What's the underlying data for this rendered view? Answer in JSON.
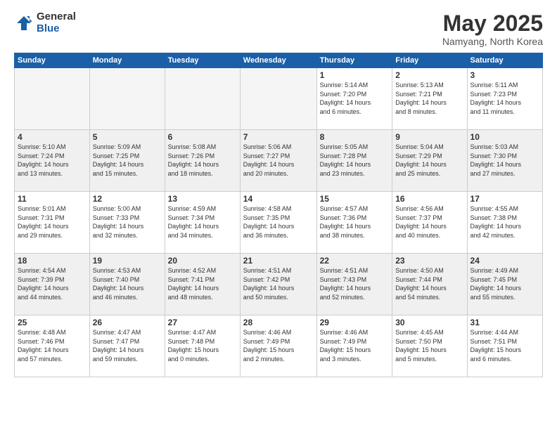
{
  "logo": {
    "general": "General",
    "blue": "Blue"
  },
  "title": "May 2025",
  "location": "Namyang, North Korea",
  "days_of_week": [
    "Sunday",
    "Monday",
    "Tuesday",
    "Wednesday",
    "Thursday",
    "Friday",
    "Saturday"
  ],
  "weeks": [
    [
      {
        "day": "",
        "info": ""
      },
      {
        "day": "",
        "info": ""
      },
      {
        "day": "",
        "info": ""
      },
      {
        "day": "",
        "info": ""
      },
      {
        "day": "1",
        "info": "Sunrise: 5:14 AM\nSunset: 7:20 PM\nDaylight: 14 hours\nand 6 minutes."
      },
      {
        "day": "2",
        "info": "Sunrise: 5:13 AM\nSunset: 7:21 PM\nDaylight: 14 hours\nand 8 minutes."
      },
      {
        "day": "3",
        "info": "Sunrise: 5:11 AM\nSunset: 7:23 PM\nDaylight: 14 hours\nand 11 minutes."
      }
    ],
    [
      {
        "day": "4",
        "info": "Sunrise: 5:10 AM\nSunset: 7:24 PM\nDaylight: 14 hours\nand 13 minutes."
      },
      {
        "day": "5",
        "info": "Sunrise: 5:09 AM\nSunset: 7:25 PM\nDaylight: 14 hours\nand 15 minutes."
      },
      {
        "day": "6",
        "info": "Sunrise: 5:08 AM\nSunset: 7:26 PM\nDaylight: 14 hours\nand 18 minutes."
      },
      {
        "day": "7",
        "info": "Sunrise: 5:06 AM\nSunset: 7:27 PM\nDaylight: 14 hours\nand 20 minutes."
      },
      {
        "day": "8",
        "info": "Sunrise: 5:05 AM\nSunset: 7:28 PM\nDaylight: 14 hours\nand 23 minutes."
      },
      {
        "day": "9",
        "info": "Sunrise: 5:04 AM\nSunset: 7:29 PM\nDaylight: 14 hours\nand 25 minutes."
      },
      {
        "day": "10",
        "info": "Sunrise: 5:03 AM\nSunset: 7:30 PM\nDaylight: 14 hours\nand 27 minutes."
      }
    ],
    [
      {
        "day": "11",
        "info": "Sunrise: 5:01 AM\nSunset: 7:31 PM\nDaylight: 14 hours\nand 29 minutes."
      },
      {
        "day": "12",
        "info": "Sunrise: 5:00 AM\nSunset: 7:33 PM\nDaylight: 14 hours\nand 32 minutes."
      },
      {
        "day": "13",
        "info": "Sunrise: 4:59 AM\nSunset: 7:34 PM\nDaylight: 14 hours\nand 34 minutes."
      },
      {
        "day": "14",
        "info": "Sunrise: 4:58 AM\nSunset: 7:35 PM\nDaylight: 14 hours\nand 36 minutes."
      },
      {
        "day": "15",
        "info": "Sunrise: 4:57 AM\nSunset: 7:36 PM\nDaylight: 14 hours\nand 38 minutes."
      },
      {
        "day": "16",
        "info": "Sunrise: 4:56 AM\nSunset: 7:37 PM\nDaylight: 14 hours\nand 40 minutes."
      },
      {
        "day": "17",
        "info": "Sunrise: 4:55 AM\nSunset: 7:38 PM\nDaylight: 14 hours\nand 42 minutes."
      }
    ],
    [
      {
        "day": "18",
        "info": "Sunrise: 4:54 AM\nSunset: 7:39 PM\nDaylight: 14 hours\nand 44 minutes."
      },
      {
        "day": "19",
        "info": "Sunrise: 4:53 AM\nSunset: 7:40 PM\nDaylight: 14 hours\nand 46 minutes."
      },
      {
        "day": "20",
        "info": "Sunrise: 4:52 AM\nSunset: 7:41 PM\nDaylight: 14 hours\nand 48 minutes."
      },
      {
        "day": "21",
        "info": "Sunrise: 4:51 AM\nSunset: 7:42 PM\nDaylight: 14 hours\nand 50 minutes."
      },
      {
        "day": "22",
        "info": "Sunrise: 4:51 AM\nSunset: 7:43 PM\nDaylight: 14 hours\nand 52 minutes."
      },
      {
        "day": "23",
        "info": "Sunrise: 4:50 AM\nSunset: 7:44 PM\nDaylight: 14 hours\nand 54 minutes."
      },
      {
        "day": "24",
        "info": "Sunrise: 4:49 AM\nSunset: 7:45 PM\nDaylight: 14 hours\nand 55 minutes."
      }
    ],
    [
      {
        "day": "25",
        "info": "Sunrise: 4:48 AM\nSunset: 7:46 PM\nDaylight: 14 hours\nand 57 minutes."
      },
      {
        "day": "26",
        "info": "Sunrise: 4:47 AM\nSunset: 7:47 PM\nDaylight: 14 hours\nand 59 minutes."
      },
      {
        "day": "27",
        "info": "Sunrise: 4:47 AM\nSunset: 7:48 PM\nDaylight: 15 hours\nand 0 minutes."
      },
      {
        "day": "28",
        "info": "Sunrise: 4:46 AM\nSunset: 7:49 PM\nDaylight: 15 hours\nand 2 minutes."
      },
      {
        "day": "29",
        "info": "Sunrise: 4:46 AM\nSunset: 7:49 PM\nDaylight: 15 hours\nand 3 minutes."
      },
      {
        "day": "30",
        "info": "Sunrise: 4:45 AM\nSunset: 7:50 PM\nDaylight: 15 hours\nand 5 minutes."
      },
      {
        "day": "31",
        "info": "Sunrise: 4:44 AM\nSunset: 7:51 PM\nDaylight: 15 hours\nand 6 minutes."
      }
    ]
  ]
}
